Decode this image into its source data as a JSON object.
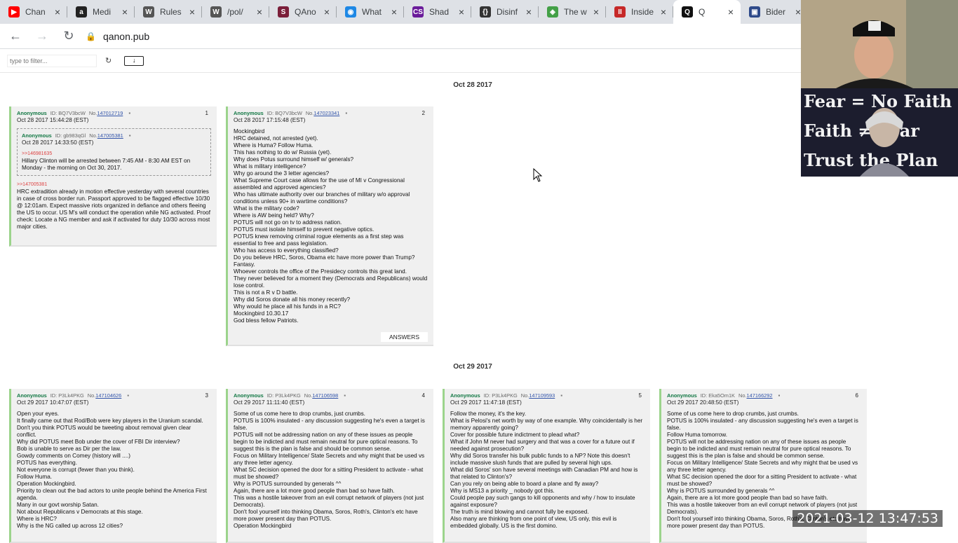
{
  "browser": {
    "tabs": [
      {
        "title": "Chan",
        "icon": "youtube-icon",
        "color": "#ff0000",
        "glyph": "▶"
      },
      {
        "title": "Medi",
        "icon": "amazon-icon",
        "color": "#222222",
        "glyph": "a"
      },
      {
        "title": "Rules",
        "icon": "wikipedia-icon",
        "color": "#555555",
        "glyph": "W"
      },
      {
        "title": "/pol/",
        "icon": "wikipedia-icon",
        "color": "#555555",
        "glyph": "W"
      },
      {
        "title": "QAno",
        "icon": "s-logo-icon",
        "color": "#7b1f3a",
        "glyph": "S"
      },
      {
        "title": "What",
        "icon": "globe-icon",
        "color": "#1e88e5",
        "glyph": "◉"
      },
      {
        "title": "Shad",
        "icon": "cs-logo-icon",
        "color": "#6a1b9a",
        "glyph": "CS"
      },
      {
        "title": "Disinf",
        "icon": "code-braces-icon",
        "color": "#333333",
        "glyph": "{}"
      },
      {
        "title": "The w",
        "icon": "sticker-icon",
        "color": "#43a047",
        "glyph": "◈"
      },
      {
        "title": "Inside",
        "icon": "insider-logo-icon",
        "color": "#c62828",
        "glyph": "II"
      },
      {
        "title": "Q",
        "icon": "q-logo-icon",
        "color": "#111111",
        "glyph": "Q",
        "active": true
      },
      {
        "title": "Bider",
        "icon": "game-icon",
        "color": "#2e4a8a",
        "glyph": "▣"
      }
    ],
    "url": "qanon.pub"
  },
  "filter": {
    "placeholder": "type to filter...",
    "refresh_glyph": "↻",
    "download_glyph": "↓"
  },
  "dates": [
    "Oct 28 2017",
    "Oct 29 2017"
  ],
  "posts": [
    {
      "author": "Anonymous",
      "id": "ID: BQ7V3bcW",
      "no_prefix": "No.",
      "no": "147012719",
      "num": "1",
      "date": "Oct 28 2017 15:44:28 (EST)",
      "reply": {
        "author": "Anonymous",
        "id": "ID: gb983qGl",
        "no_prefix": "No.",
        "no": "147005381",
        "date": "Oct 28 2017 14:33:50 (EST)",
        "quote": ">>146981635",
        "text": "Hillary Clinton will be arrested between 7:45 AM - 8:30 AM EST on Monday - the morning on Oct 30, 2017."
      },
      "quote": ">>147005381",
      "text": "HRC extradition already in motion effective yesterday with several countries in case of cross border run. Passport approved to be flagged effective 10/30 @ 12:01am. Expect massive riots organized in defiance and others fleeing the US to occur. US M's will conduct the operation while NG activated. Proof check: Locate a NG member and ask if activated for duty 10/30 across most major cities."
    },
    {
      "author": "Anonymous",
      "id": "ID: BQ7V3bcW",
      "no_prefix": "No.",
      "no": "147023341",
      "num": "2",
      "date": "Oct 28 2017 17:15:48 (EST)",
      "text": "Mockingbird\nHRC detained, not arrested (yet).\nWhere is Huma? Follow Huma.\nThis has nothing to do w/ Russia (yet).\nWhy does Potus surround himself w/ generals?\nWhat is military intelligence?\nWhy go around the 3 letter agencies?\nWhat Supreme Court case allows for the use of MI v Congressional assembled and approved agencies?\nWho has ultimate authority over our branches of military w/o approval conditions unless 90+ in wartime conditions?\nWhat is the military code?\nWhere is AW being held? Why?\nPOTUS will not go on tv to address nation.\nPOTUS must isolate himself to prevent negative optics.\nPOTUS knew removing criminal rogue elements as a first step was essential to free and pass legislation.\nWho has access to everything classified?\nDo you believe HRC, Soros, Obama etc have more power than Trump? Fantasy.\nWhoever controls the office of the Presidecy controls this great land.\nThey never believed for a moment they (Democrats and Republicans) would lose control.\nThis is not a R v D battle.\nWhy did Soros donate all his money recently?\nWhy would he place all his funds in a RC?\nMockingbird 10.30.17\nGod bless fellow Patriots.",
      "answers": "ANSWERS"
    },
    {
      "author": "Anonymous",
      "id": "ID: P3Lk4PKG",
      "no_prefix": "No.",
      "no": "147104626",
      "num": "3",
      "date": "Oct 29 2017 10:47:07 (EST)",
      "text": "Open your eyes.\nIt finally came out that Rod/Bob were key players in the Uranium scandal.\nDon't you think POTUS would be tweeting about removal given clear conflict.\nWhy did POTUS meet Bob under the cover of FBI Dir interview?\nBob is unable to serve as Dir per the law.\nGowdy comments on Comey (history will ....)\nPOTUS has everything.\nNot everyone is corrupt (fewer than you think).\nFollow Huma.\nOperation Mockingbird.\nPriority to clean out the bad actors to unite people behind the America First agenda.\nMany in our govt worship Satan.\nNot about Republicans v Democrats at this stage.\nWhere is HRC?\nWhy is the NG called up across 12 cities?"
    },
    {
      "author": "Anonymous",
      "id": "ID: P3Lk4PKG",
      "no_prefix": "No.",
      "no": "147106598",
      "num": "4",
      "date": "Oct 29 2017 11:11:40 (EST)",
      "text": "Some of us come here to drop crumbs, just crumbs.\nPOTUS is 100% insulated - any discussion suggesting he's even a target is false.\nPOTUS will not be addressing nation on any of these issues as people begin to be indicted and must remain neutral for pure optical reasons. To suggest this is the plan is false and should be common sense.\nFocus on Military Intelligence/ State Secrets and why might that be used vs any three letter agency.\nWhat SC decision opened the door for a sitting President to activate - what must be showed?\nWhy is POTUS surrounded by generals ^^\nAgain, there are a lot more good people than bad so have faith.\nThis was a hostile takeover from an evil corrupt network of players (not just Democrats).\nDon't fool yourself into thinking Obama, Soros, Roth's, Clinton's etc have more power present day than POTUS.\nOperation Mockingbird"
    },
    {
      "author": "Anonymous",
      "id": "ID: P3Lk4PKG",
      "no_prefix": "No.",
      "no": "147109593",
      "num": "5",
      "date": "Oct 29 2017 11:47:18 (EST)",
      "text": "Follow the money, it's the key.\nWhat is Pelosi's net worth by way of one example. Why coincidentally is her memory apparently going?\nCover for possible future indictment to plead what?\nWhat if John M never had surgery and that was a cover for a future out if needed against prosecution?\nWhy did Soros transfer his bulk public funds to a NP? Note this doesn't include massive slush funds that are pulled by several high ups.\nWhat did Soros' son have several meetings with Canadian PM and how is that related to Clinton's?\nCan you rely on being able to board a plane and fly away?\nWhy is MS13 a priority _ nobody got this.\nCould people pay such gangs to kill opponents and why / how to insulate against exposure?\nThe truth is mind blowing and cannot fully be exposed.\nAlso many are thinking from one point of view, US only, this evil is embedded globally. US is the first domino."
    },
    {
      "author": "Anonymous",
      "id": "ID: Eka5Om1K",
      "no_prefix": "No.",
      "no": "147166292",
      "num": "6",
      "date": "Oct 29 2017 20:48:50 (EST)",
      "text": "Some of us come here to drop crumbs, just crumbs.\nPOTUS is 100% insulated - any discussion suggesting he's even a target is false.\nFollow Huma tomorrow.\nPOTUS will not be addressing nation on any of these issues as people begin to be indicted and must remain neutral for pure optical reasons. To suggest this is the plan is false and should be common sense.\nFocus on Military Intelligence/ State Secrets and why might that be used vs any three letter agency.\nWhat SC decision opened the door for a sitting President to activate - what must be showed?\nWhy is POTUS surrounded by generals ^^\nAgain, there are a lot more good people than bad so have faith.\nThis was a hostile takeover from an evil corrupt network of players (not just Democrats).\nDon't fool yourself into thinking Obama, Soros, Roth's, Clinton's etc have more power present day than POTUS."
    }
  ],
  "overlay": {
    "cam2_lines": [
      "Fear = No Faith",
      "Faith ≠ Fear",
      "Trust the Plan"
    ],
    "timestamp": "2021-03-12  13:47:53"
  }
}
